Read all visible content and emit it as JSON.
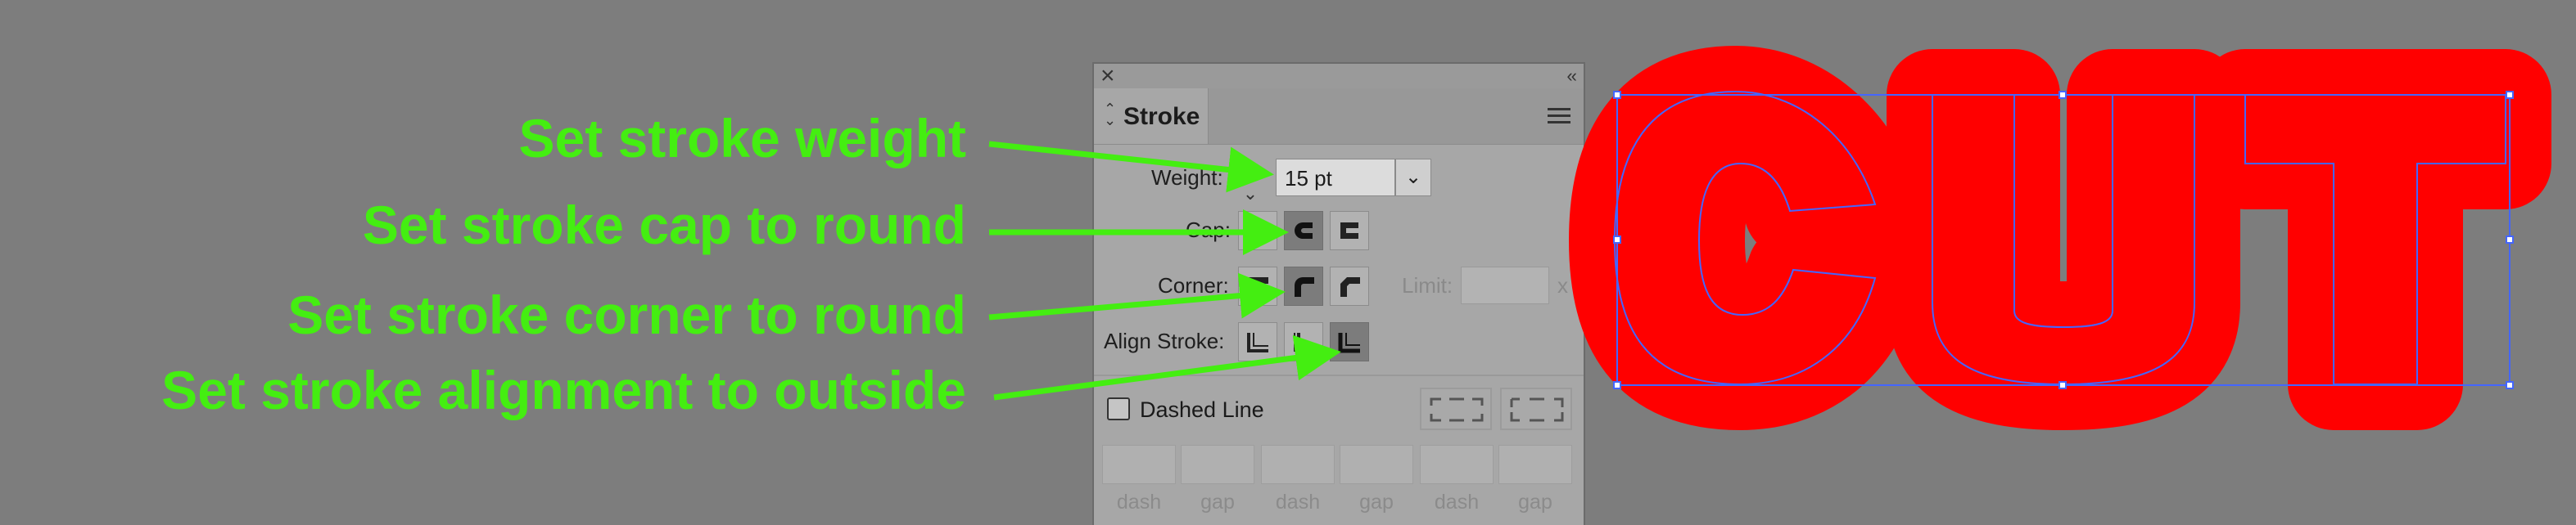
{
  "annotations": [
    "Set stroke weight",
    "Set stroke cap to round",
    "Set stroke corner to round",
    "Set stroke alignment to outside"
  ],
  "colors": {
    "annotation": "#44ee11",
    "artwork_fill": "#ff0000",
    "selection": "#4466ff",
    "background": "#7d7d7d"
  },
  "panel": {
    "tab_label": "Stroke",
    "weight_label": "Weight:",
    "weight_value": "15 pt",
    "cap_label": "Cap:",
    "corner_label": "Corner:",
    "limit_label": "Limit:",
    "limit_unit": "x",
    "align_label": "Align Stroke:",
    "dashed_label": "Dashed Line",
    "dashed_checked": false,
    "dash_fields": [
      "dash",
      "gap",
      "dash",
      "gap",
      "dash",
      "gap"
    ],
    "cap_options": [
      "butt-cap-icon",
      "round-cap-icon",
      "projecting-cap-icon"
    ],
    "cap_selected": "round-cap-icon",
    "corner_options": [
      "miter-join-icon",
      "round-join-icon",
      "bevel-join-icon"
    ],
    "corner_selected": "round-join-icon",
    "align_options": [
      "align-center-icon",
      "align-inside-icon",
      "align-outside-icon"
    ],
    "align_selected": "align-outside-icon"
  },
  "artwork": {
    "text": "CUT"
  }
}
